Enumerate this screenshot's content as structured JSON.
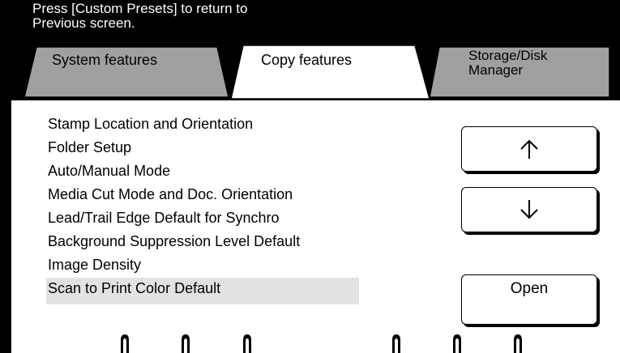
{
  "prompt_text": "Press [Custom Presets] to return to\nPrevious screen.",
  "tabs": [
    {
      "label": "System features",
      "active": false
    },
    {
      "label": "Copy features",
      "active": true
    },
    {
      "label": "Storage/Disk\nManager",
      "active": false
    }
  ],
  "features": [
    "Stamp Location and Orientation",
    "Folder Setup",
    "Auto/Manual Mode",
    "Media Cut Mode and Doc. Orientation",
    "Lead/Trail Edge Default for Synchro",
    "Background Suppression Level Default",
    "Image Density",
    "Scan to Print Color Default"
  ],
  "selected_feature": "Scan to Print Color Default",
  "buttons": {
    "up_icon": "arrow-up-icon",
    "down_icon": "arrow-down-icon",
    "open_label": "Open"
  },
  "colors": {
    "frame": "#000000",
    "highlight": "#e2e2e2",
    "background": "#ffffff"
  }
}
